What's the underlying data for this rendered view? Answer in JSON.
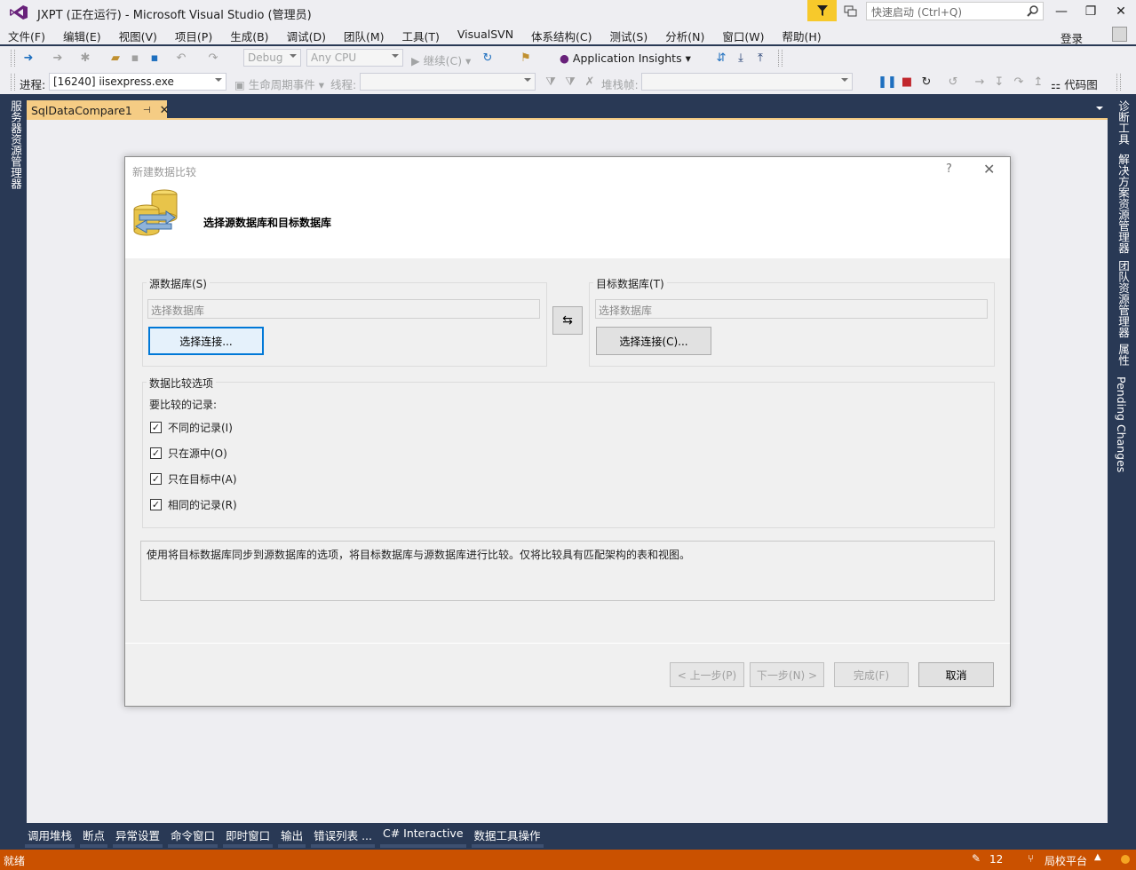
{
  "window": {
    "title": "JXPT (正在运行) - Microsoft Visual Studio (管理员)",
    "quick_launch_placeholder": "快速启动 (Ctrl+Q)",
    "controls": [
      "—",
      "❐",
      "✕"
    ]
  },
  "menu": {
    "items": [
      "文件(F)",
      "编辑(E)",
      "视图(V)",
      "项目(P)",
      "生成(B)",
      "调试(D)",
      "团队(M)",
      "工具(T)",
      "VisualSVN",
      "体系结构(C)",
      "测试(S)",
      "分析(N)",
      "窗口(W)",
      "帮助(H)"
    ],
    "login": "登录"
  },
  "toolbar1": {
    "config": "Debug",
    "platform": "Any CPU",
    "continue": "继续(C)",
    "app_insights": "Application Insights"
  },
  "toolbar2": {
    "process_label": "进程:",
    "process_value": "[16240] iisexpress.exe",
    "lifecycle": "生命周期事件",
    "thread_label": "线程:",
    "stackframe_label": "堆栈帧:",
    "codemap": "代码图"
  },
  "left_rail": {
    "items": [
      "服务器资源管理器"
    ]
  },
  "right_rail": {
    "items": [
      "诊断工具",
      "解决方案资源管理器",
      "团队资源管理器",
      "属性",
      "Pending Changes"
    ]
  },
  "doc_tab": {
    "title": "SqlDataCompare1",
    "pin": "⊣",
    "close": "✕"
  },
  "dialog": {
    "title": "新建数据比较",
    "help": "?",
    "close": "✕",
    "heading": "选择源数据库和目标数据库",
    "source": {
      "group_label": "源数据库(S)",
      "placeholder": "选择数据库",
      "connect_button": "选择连接..."
    },
    "swap_button": "⇆",
    "target": {
      "group_label": "目标数据库(T)",
      "placeholder": "选择数据库",
      "connect_button": "选择连接(C)..."
    },
    "options": {
      "group_label": "数据比较选项",
      "records_label": "要比较的记录:",
      "checkboxes": [
        {
          "label": "不同的记录(I)",
          "checked": true
        },
        {
          "label": "只在源中(O)",
          "checked": true
        },
        {
          "label": "只在目标中(A)",
          "checked": true
        },
        {
          "label": "相同的记录(R)",
          "checked": true
        }
      ]
    },
    "description": "使用将目标数据库同步到源数据库的选项，将目标数据库与源数据库进行比较。仅将比较具有匹配架构的表和视图。",
    "buttons": {
      "prev": "< 上一步(P)",
      "next": "下一步(N) >",
      "finish": "完成(F)",
      "cancel": "取消"
    }
  },
  "bottom_tabs": [
    "调用堆栈",
    "断点",
    "异常设置",
    "命令窗口",
    "即时窗口",
    "输出",
    "错误列表 ...",
    "C# Interactive",
    "数据工具操作"
  ],
  "status": {
    "left": "就绪",
    "pencil_count": "12",
    "branch": "局校平台",
    "accent": "#ca5100"
  }
}
